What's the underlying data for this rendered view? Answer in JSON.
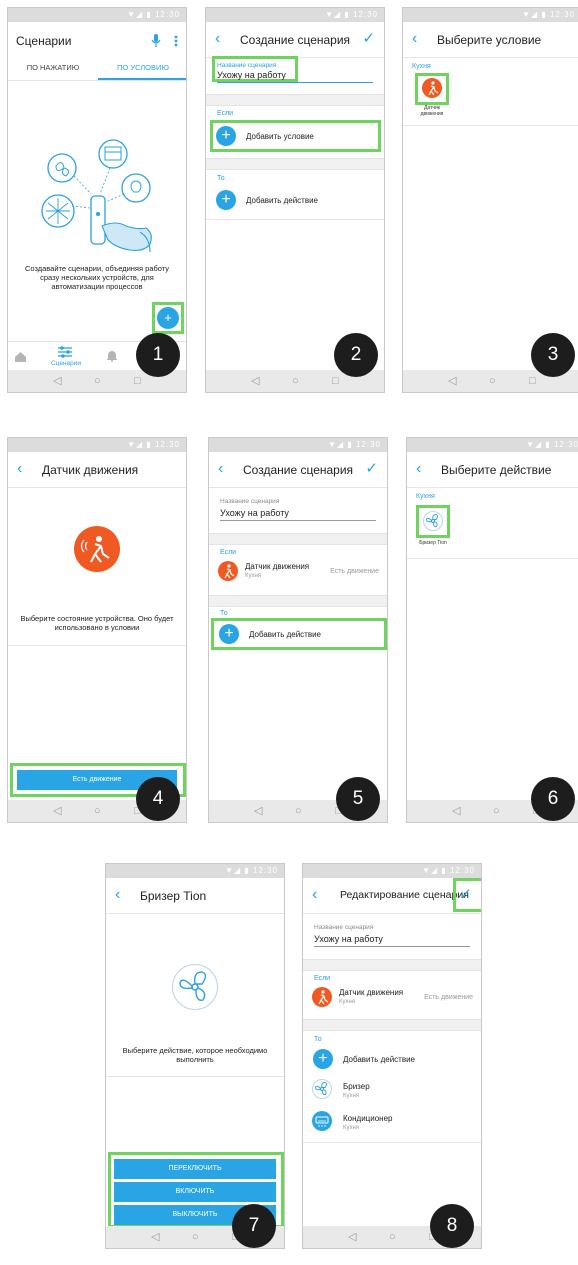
{
  "status_bar": {
    "icons": "▼◢ ▮ 12:30"
  },
  "nav": {
    "back": "◁",
    "home": "○",
    "recent": "□"
  },
  "colors": {
    "accent": "#29a5e6",
    "highlight": "#6fd45e",
    "sensor": "#f05a22",
    "badge": "#1d1d1d"
  },
  "screens": [
    {
      "step": "1",
      "title": "Сценарии",
      "tabs": [
        "ПО НАЖАТИЮ",
        "ПО УСЛОВИЮ"
      ],
      "empty_text": "Создавайте сценарии, объединяя работу сразу нескольких устройств, для автоматизации процессов",
      "fab": "+",
      "bottom_nav": {
        "active_label": "Сценарии"
      }
    },
    {
      "step": "2",
      "title": "Создание сценария",
      "name_label": "Название сценария",
      "name_value": "Ухожу на работу",
      "if_label": "Если",
      "add_condition": "Добавить условие",
      "then_label": "То",
      "add_action": "Добавить действие"
    },
    {
      "step": "3",
      "title": "Выберите условие",
      "room": "Кухня",
      "device_label": "Датчик движения"
    },
    {
      "step": "4",
      "title": "Датчик движения",
      "prompt": "Выберите состояние устройства. Оно будет использовано в условии",
      "button": "Есть движение"
    },
    {
      "step": "5",
      "title": "Создание сценария",
      "name_label": "Название сценария",
      "name_value": "Ухожу на работу",
      "if_label": "Если",
      "condition_name": "Датчик движения",
      "condition_room": "Кухня",
      "condition_state": "Есть движение",
      "then_label": "То",
      "add_action": "Добавить действие"
    },
    {
      "step": "6",
      "title": "Выберите действие",
      "room": "Кухня",
      "device_label": "Бризер Tion"
    },
    {
      "step": "7",
      "title": "Бризер Tion",
      "prompt": "Выберите действие, которое необходимо выполнить",
      "buttons": [
        "ПЕРЕКЛЮЧИТЬ",
        "ВКЛЮЧИТЬ",
        "ВЫКЛЮЧИТЬ"
      ]
    },
    {
      "step": "8",
      "title": "Редактирование сценария",
      "name_label": "Название сценария",
      "name_value": "Ухожу на работу",
      "if_label": "Если",
      "condition_name": "Датчик движения",
      "condition_room": "Кухня",
      "condition_state": "Есть движение",
      "then_label": "То",
      "add_action": "Добавить действие",
      "actions": [
        {
          "name": "Бризер",
          "room": "Кухня"
        },
        {
          "name": "Кондиционер",
          "room": "Кухня"
        }
      ]
    }
  ]
}
